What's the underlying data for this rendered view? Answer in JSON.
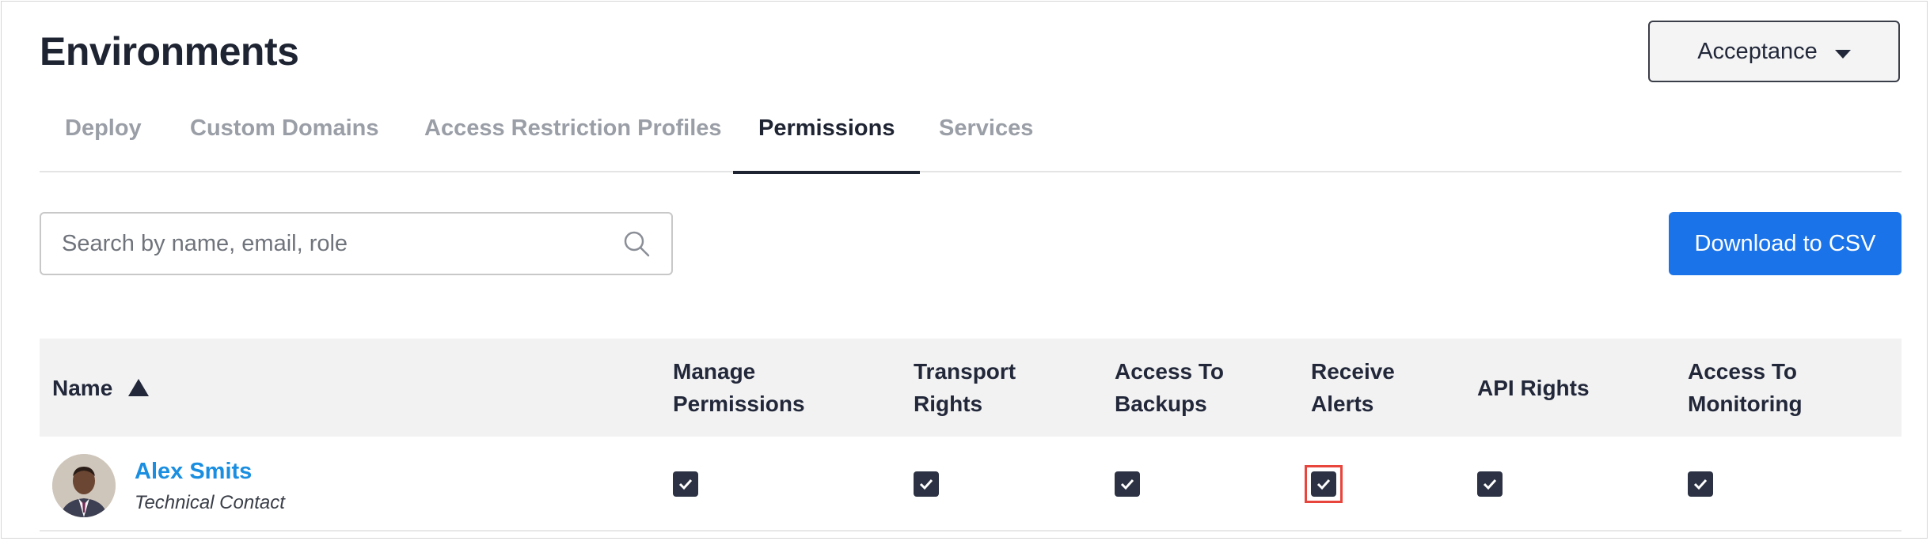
{
  "header": {
    "title": "Environments",
    "environment_select": {
      "value": "Acceptance"
    }
  },
  "tabs": [
    {
      "label": "Deploy",
      "active": false
    },
    {
      "label": "Custom Domains",
      "active": false
    },
    {
      "label": "Access Restriction Profiles",
      "active": false
    },
    {
      "label": "Permissions",
      "active": true
    },
    {
      "label": "Services",
      "active": false
    }
  ],
  "toolbar": {
    "search_placeholder": "Search by name, email, role",
    "download_label": "Download to CSV"
  },
  "table": {
    "columns": [
      {
        "line1": "Name",
        "line2": "",
        "sorted": "ascending"
      },
      {
        "line1": "Manage",
        "line2": "Permissions"
      },
      {
        "line1": "Transport",
        "line2": "Rights"
      },
      {
        "line1": "Access To",
        "line2": "Backups"
      },
      {
        "line1": "Receive",
        "line2": "Alerts"
      },
      {
        "line1": "API Rights",
        "line2": ""
      },
      {
        "line1": "Access To",
        "line2": "Monitoring"
      }
    ],
    "rows": [
      {
        "name": "Alex Smits",
        "role": "Technical Contact",
        "manage_permissions": true,
        "transport_rights": true,
        "access_to_backups": true,
        "receive_alerts": true,
        "api_rights": true,
        "access_to_monitoring": true
      }
    ]
  },
  "colors": {
    "primary_button": "#1a73e8",
    "link": "#1a8ee0",
    "checkbox": "#2c3244",
    "highlight": "#e8453c"
  }
}
